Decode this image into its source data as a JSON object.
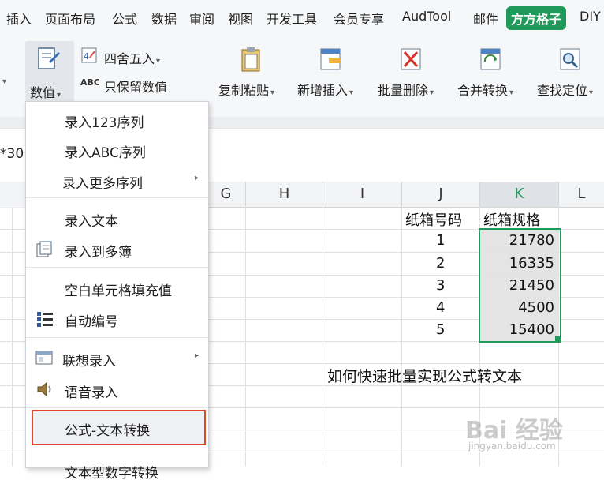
{
  "menu_tabs": [
    "插入",
    "页面布局",
    "公式",
    "数据",
    "审阅",
    "视图",
    "开发工具",
    "会员专享",
    "AudTool",
    "邮件",
    "方方格子",
    "DIY"
  ],
  "ribbon": {
    "numbers": "数值",
    "round": "四舍五入",
    "keep_values": "只保留数值",
    "copy_paste": "复制粘贴",
    "insert_new": "新增插入",
    "batch_delete": "批量删除",
    "merge_convert": "合并转换",
    "find_locate": "查找定位"
  },
  "formula_fragment": "*30",
  "columns": [
    "G",
    "H",
    "I",
    "J",
    "K",
    "L"
  ],
  "table": {
    "header_j": "纸箱号码",
    "header_k": "纸箱规格",
    "rows": [
      {
        "j": "1",
        "k": "21780"
      },
      {
        "j": "2",
        "k": "16335"
      },
      {
        "j": "3",
        "k": "21450"
      },
      {
        "j": "4",
        "k": "4500"
      },
      {
        "j": "5",
        "k": "15400"
      }
    ]
  },
  "caption": "如何快速批量实现公式转文本",
  "dropdown": [
    "录入123序列",
    "录入ABC序列",
    "录入更多序列",
    "录入文本",
    "录入到多簿",
    "空白单元格填充值",
    "自动编号",
    "联想录入",
    "语音录入",
    "公式-文本转换",
    "文本型数字转换"
  ],
  "watermark": "Bai 经验",
  "watermark_url": "jingyan.baidu.com",
  "colors": {
    "accent": "#1f9a5a",
    "highlight_border": "#e0462f",
    "selection": "#1f9a5a"
  }
}
